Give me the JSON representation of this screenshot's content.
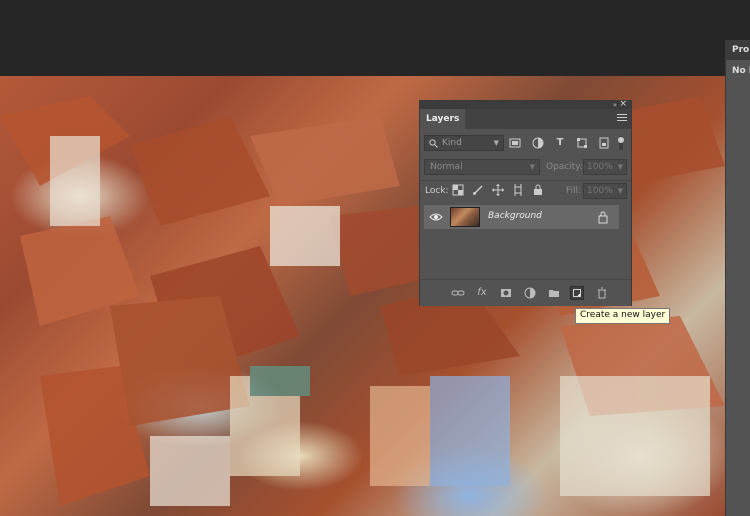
{
  "app": {
    "document_background": "#262626"
  },
  "properties_panel": {
    "title": "Prop",
    "subtitle": "No l"
  },
  "layers_panel": {
    "tab_label": "Layers",
    "filter": {
      "kind_label": "Kind",
      "icons": [
        "image-filter-icon",
        "adjustment-filter-icon",
        "type-filter-icon",
        "shape-filter-icon",
        "smart-object-filter-icon"
      ]
    },
    "blend_mode": "Normal",
    "opacity_label": "Opacity:",
    "opacity_value": "100%",
    "lock_label": "Lock:",
    "lock_icons": [
      "lock-transparent-icon",
      "lock-pixels-icon",
      "lock-position-icon",
      "lock-artboard-icon",
      "lock-all-icon"
    ],
    "fill_label": "Fill:",
    "fill_value": "100%",
    "layers": [
      {
        "name": "Background",
        "visible": true,
        "locked": true
      }
    ],
    "footer_icons": [
      "link-layers-icon",
      "fx-icon",
      "mask-icon",
      "adjustment-icon",
      "group-folder-icon",
      "new-layer-icon",
      "trash-icon"
    ]
  },
  "tooltip": {
    "text": "Create a new layer"
  }
}
